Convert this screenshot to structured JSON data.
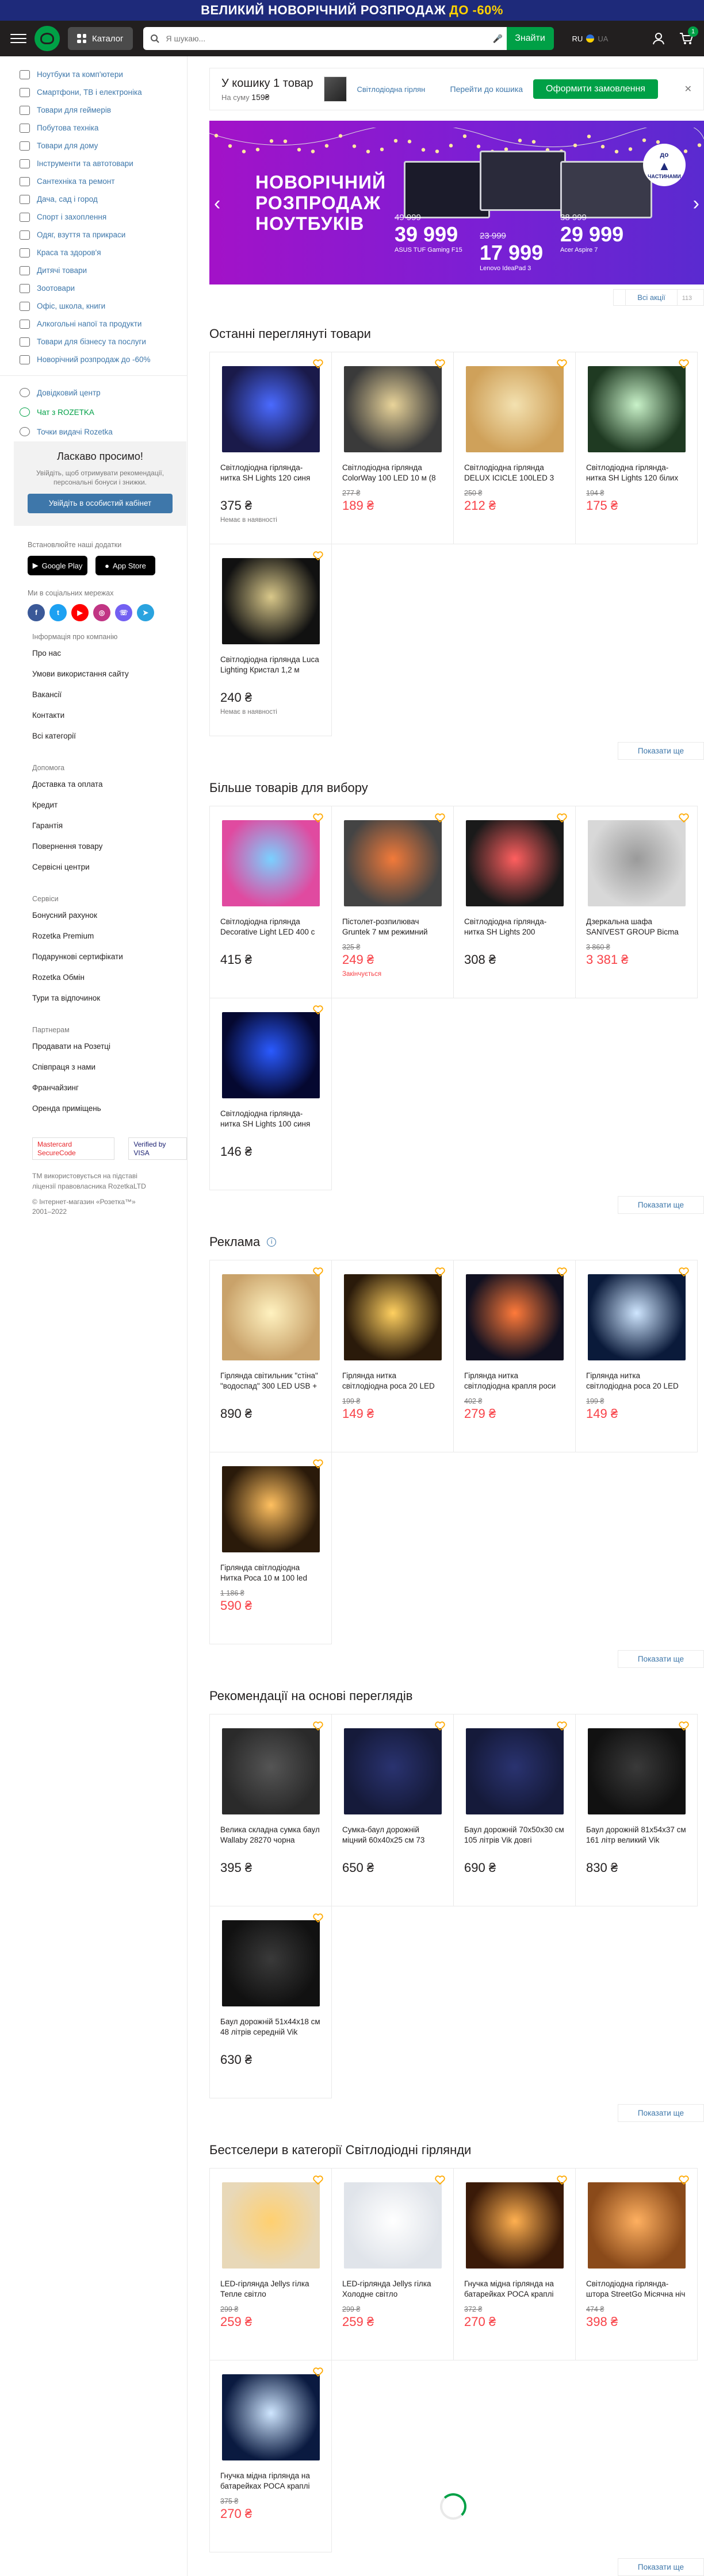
{
  "promo": {
    "text": "ВЕЛИКИЙ НОВОРІЧНИЙ РОЗПРОДАЖ",
    "highlight": "ДО -60%"
  },
  "header": {
    "catalog_label": "Каталог",
    "search_placeholder": "Я шукаю...",
    "find_label": "Знайти",
    "lang_ru": "RU",
    "lang_ua": "UA",
    "cart_count": "1"
  },
  "sidebar": {
    "categories": [
      "Ноутбуки та комп'ютери",
      "Смартфони, ТВ і електроніка",
      "Товари для геймерів",
      "Побутова техніка",
      "Товари для дому",
      "Інструменти та автотовари",
      "Сантехніка та ремонт",
      "Дача, сад і город",
      "Спорт і захоплення",
      "Одяг, взуття та прикраси",
      "Краса та здоров'я",
      "Дитячі товари",
      "Зоотовари",
      "Офіс, школа, книги",
      "Алкогольні напої та продукти",
      "Товари для бізнесу та послуги",
      "Новорічний розпродаж до -60%"
    ],
    "links": [
      "Довідковий центр",
      "Чат з ROZETKA",
      "Точки видачі Rozetka"
    ],
    "welcome": {
      "title": "Ласкаво просимо!",
      "text": "Увійдіть, щоб отримувати рекомендації, персональні бонуси і знижки.",
      "button": "Увійдіть в особистий кабінет"
    },
    "apps_title": "Встановлюйте наші додатки",
    "google_play": "Google Play",
    "app_store": "App Store",
    "social_title": "Ми в соціальних мережах",
    "footer": [
      {
        "heading": "Інформація про компанію",
        "items": [
          "Про нас",
          "Умови використання сайту",
          "Вакансії",
          "Контакти",
          "Всі категорії"
        ]
      },
      {
        "heading": "Допомога",
        "items": [
          "Доставка та оплата",
          "Кредит",
          "Гарантія",
          "Повернення товару",
          "Сервісні центри"
        ]
      },
      {
        "heading": "Сервіси",
        "items": [
          "Бонусний рахунок",
          "Rozetka Premium",
          "Подарункові сертифікати",
          "Rozetka Обмін",
          "Тури та відпочинок"
        ]
      },
      {
        "heading": "Партнерам",
        "items": [
          "Продавати на Розетці",
          "Співпраця з нами",
          "Франчайзинг",
          "Оренда приміщень"
        ]
      }
    ],
    "pay_mc": "Mastercard SecureCode",
    "pay_visa": "Verified by VISA",
    "copyright": "TM використовується на підставі ліцензії правовласника RozetkaLTD",
    "copyright2": "© Інтернет-магазин «Розетка™» 2001–2022"
  },
  "cart": {
    "title": "У кошику 1 товар",
    "sum_label": "На суму",
    "sum": "159₴",
    "product": "Світлодіодна гірлян",
    "goto": "Перейти до кошика",
    "order": "Оформити замовлення"
  },
  "banner": {
    "title_line1": "НОВОРІЧНИЙ",
    "title_line2": "РОЗПРОДАЖ",
    "title_line3": "НОУТБУКІВ",
    "p1_old": "49 999",
    "p1_new": "39 999",
    "p1_name": "ASUS TUF Gaming F15",
    "p2_old": "23 999",
    "p2_new": "17 999",
    "p2_name": "Lenovo IdeaPad 3",
    "p3_old": "38 999",
    "p3_new": "29 999",
    "p3_name": "Acer Aspire 7",
    "badge_top": "до",
    "badge_bottom": "ЧАСТИНАМИ"
  },
  "all_actions": {
    "label": "Всі акції",
    "count": "113"
  },
  "sections": {
    "recent": {
      "title": "Останні переглянуті товари",
      "more": "Показати ще",
      "items": [
        {
          "name": "Світлодіодна гірлянда-нитка SH Lights 120 синя",
          "old": "",
          "price": "375 ₴",
          "red": false,
          "stock": "Немає в наявності",
          "c1": "#1a1a4a",
          "c2": "#4a6aff"
        },
        {
          "name": "Світлодіодна гірлянда ColorWay 100 LED 10 м (8",
          "old": "277 ₴",
          "price": "189 ₴",
          "red": true,
          "stock": "",
          "c1": "#3a3a3a",
          "c2": "#e9d49a"
        },
        {
          "name": "Світлодіодна гірлянда DELUX ICICLE 100LED 3",
          "old": "250 ₴",
          "price": "212 ₴",
          "red": true,
          "stock": "",
          "c1": "#cfa15a",
          "c2": "#f3e1b0"
        },
        {
          "name": "Світлодіодна гірлянда-нитка SH Lights 120 білих",
          "old": "194 ₴",
          "price": "175 ₴",
          "red": true,
          "stock": "",
          "c1": "#1f3a22",
          "c2": "#c9f2c9"
        },
        {
          "name": "Світлодіодна гірлянда Luca Lighting Кристал 1,2 м",
          "old": "",
          "price": "240 ₴",
          "red": false,
          "stock": "Немає в наявності",
          "c1": "#111",
          "c2": "#d9c88a"
        }
      ]
    },
    "more_choice": {
      "title": "Більше товарів для вибору",
      "more": "Показати ще",
      "items": [
        {
          "name": "Світлодіодна гірлянда Decorative Light LED 400 с",
          "old": "",
          "price": "415 ₴",
          "red": false,
          "stock": "",
          "c1": "#e04aa0",
          "c2": "#7ad0ff"
        },
        {
          "name": "Пістолет-розпилювач Gruntek 7 мм режимний",
          "old": "325 ₴",
          "price": "249 ₴",
          "red": true,
          "stock": "Закінчується",
          "c1": "#444",
          "c2": "#f27a3a"
        },
        {
          "name": "Світлодіодна гірлянда-нитка SH Lights 200",
          "old": "",
          "price": "308 ₴",
          "red": false,
          "stock": "",
          "c1": "#1a1a1a",
          "c2": "#ff5f5f"
        },
        {
          "name": "Дзеркальна шафа SANIVEST GROUP Bicma",
          "old": "3 860 ₴",
          "price": "3 381 ₴",
          "red": true,
          "stock": "",
          "c1": "#d8d8d8",
          "c2": "#9a9a9a"
        },
        {
          "name": "Світлодіодна гірлянда-нитка SH Lights 100 синя",
          "old": "",
          "price": "146 ₴",
          "red": false,
          "stock": "",
          "c1": "#050830",
          "c2": "#2a5aff"
        }
      ]
    },
    "ads": {
      "title": "Реклама",
      "more": "Показати ще",
      "items": [
        {
          "name": "Гірлянда світильник \"стіна\" \"водоспад\" 300 LED USB +",
          "old": "",
          "price": "890 ₴",
          "red": false,
          "stock": "",
          "c1": "#c9a26a",
          "c2": "#fff2c0"
        },
        {
          "name": "Гірлянда нитка світлодіодна роса 20 LED",
          "old": "199 ₴",
          "price": "149 ₴",
          "red": true,
          "stock": "",
          "c1": "#2a1a0a",
          "c2": "#ffd060"
        },
        {
          "name": "Гірлянда нитка світлодіодна крапля роси",
          "old": "402 ₴",
          "price": "279 ₴",
          "red": true,
          "stock": "",
          "c1": "#101020",
          "c2": "#ff7a3a"
        },
        {
          "name": "Гірлянда нитка світлодіодна роса 20 LED",
          "old": "199 ₴",
          "price": "149 ₴",
          "red": true,
          "stock": "",
          "c1": "#0a1a3a",
          "c2": "#cfe6ff"
        },
        {
          "name": "Гірлянда світлодіодна Нитка Роса 10 м 100 led",
          "old": "1 186 ₴",
          "price": "590 ₴",
          "red": true,
          "stock": "",
          "c1": "#2a1a0a",
          "c2": "#ffc060"
        }
      ]
    },
    "reco": {
      "title": "Рекомендації на основі переглядів",
      "more": "Показати ще",
      "items": [
        {
          "name": "Велика складна сумка баул Wallaby 28270 чорна",
          "old": "",
          "price": "395 ₴",
          "red": false,
          "stock": "",
          "c1": "#2a2a2a",
          "c2": "#555"
        },
        {
          "name": "Сумка-баул дорожній міцний 60х40х25 см 73",
          "old": "",
          "price": "650 ₴",
          "red": false,
          "stock": "",
          "c1": "#151a3a",
          "c2": "#2a3370"
        },
        {
          "name": "Баул дорожній 70х50х30 см 105 літрів Vik довгі",
          "old": "",
          "price": "690 ₴",
          "red": false,
          "stock": "",
          "c1": "#151a3a",
          "c2": "#2a3370"
        },
        {
          "name": "Баул дорожній 81х54х37 см 161 літр великий Vik",
          "old": "",
          "price": "830 ₴",
          "red": false,
          "stock": "",
          "c1": "#111",
          "c2": "#3a3a3a"
        },
        {
          "name": "Баул дорожній 51х44х18 см 48 літрів середній Vik",
          "old": "",
          "price": "630 ₴",
          "red": false,
          "stock": "",
          "c1": "#111",
          "c2": "#3a3a3a"
        }
      ]
    },
    "best": {
      "title": "Бестселери в категорії Світлодіодні гірлянди",
      "more": "Показати ще",
      "items": [
        {
          "name": "LED-гірлянда Jellys гілка Тепле світло",
          "old": "299 ₴",
          "price": "259 ₴",
          "red": true,
          "stock": "",
          "c1": "#e8d8b8",
          "c2": "#ffd070"
        },
        {
          "name": "LED-гірлянда Jellys гілка Холодне світло",
          "old": "299 ₴",
          "price": "259 ₴",
          "red": true,
          "stock": "",
          "c1": "#e0e4ea",
          "c2": "#ffffff"
        },
        {
          "name": "Гнучка мідна гірлянда на батарейках РОСА краплі",
          "old": "372 ₴",
          "price": "270 ₴",
          "red": true,
          "stock": "",
          "c1": "#3a1a08",
          "c2": "#ffb050"
        },
        {
          "name": "Світлодіодна гірлянда-штора StreetGo Місячна ніч",
          "old": "474 ₴",
          "price": "398 ₴",
          "red": true,
          "stock": "",
          "c1": "#8a4a1a",
          "c2": "#ffb060"
        },
        {
          "name": "Гнучка мідна гірлянда на батарейках РОСА краплі",
          "old": "375 ₴",
          "price": "270 ₴",
          "red": true,
          "stock": "",
          "c1": "#0a1a40",
          "c2": "#cfe6ff"
        }
      ]
    }
  }
}
